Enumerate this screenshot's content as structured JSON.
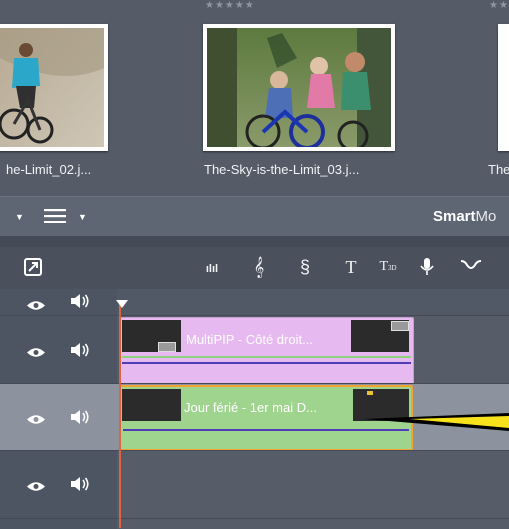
{
  "library": {
    "ratings": [
      "★★★★★",
      "★★"
    ],
    "items": [
      {
        "filename": "he-Limit_02.j..."
      },
      {
        "filename": "The-Sky-is-the-Limit_03.j..."
      },
      {
        "filename": "The"
      }
    ]
  },
  "toolbar": {
    "brand_bold": "Smart",
    "brand_cut": "Mo"
  },
  "editor_tools": [
    {
      "icon": "⧉",
      "name": "export-icon"
    },
    {
      "icon": "ılıl",
      "name": "audio-mixer-icon"
    },
    {
      "icon": "𝄞",
      "name": "music-icon"
    },
    {
      "icon": "§",
      "name": "scorefitter-icon"
    },
    {
      "icon": "T",
      "name": "title-icon"
    },
    {
      "icon": "T3D",
      "name": "title-3d-icon"
    },
    {
      "icon": "🎙",
      "name": "voiceover-icon"
    },
    {
      "icon": "⌣",
      "name": "keyframe-icon"
    }
  ],
  "tracks": [
    {
      "clip_title": "MultiPIP - Côté droit..."
    },
    {
      "clip_title": "Jour férié - 1er mai D..."
    }
  ],
  "colors": {
    "clip_pip_bg": "#e6baf0",
    "clip_title_bg": "#9fd48e",
    "selection_border": "#f2a433",
    "playhead": "#e0633f",
    "pointer_yellow": "#f7e21b"
  }
}
